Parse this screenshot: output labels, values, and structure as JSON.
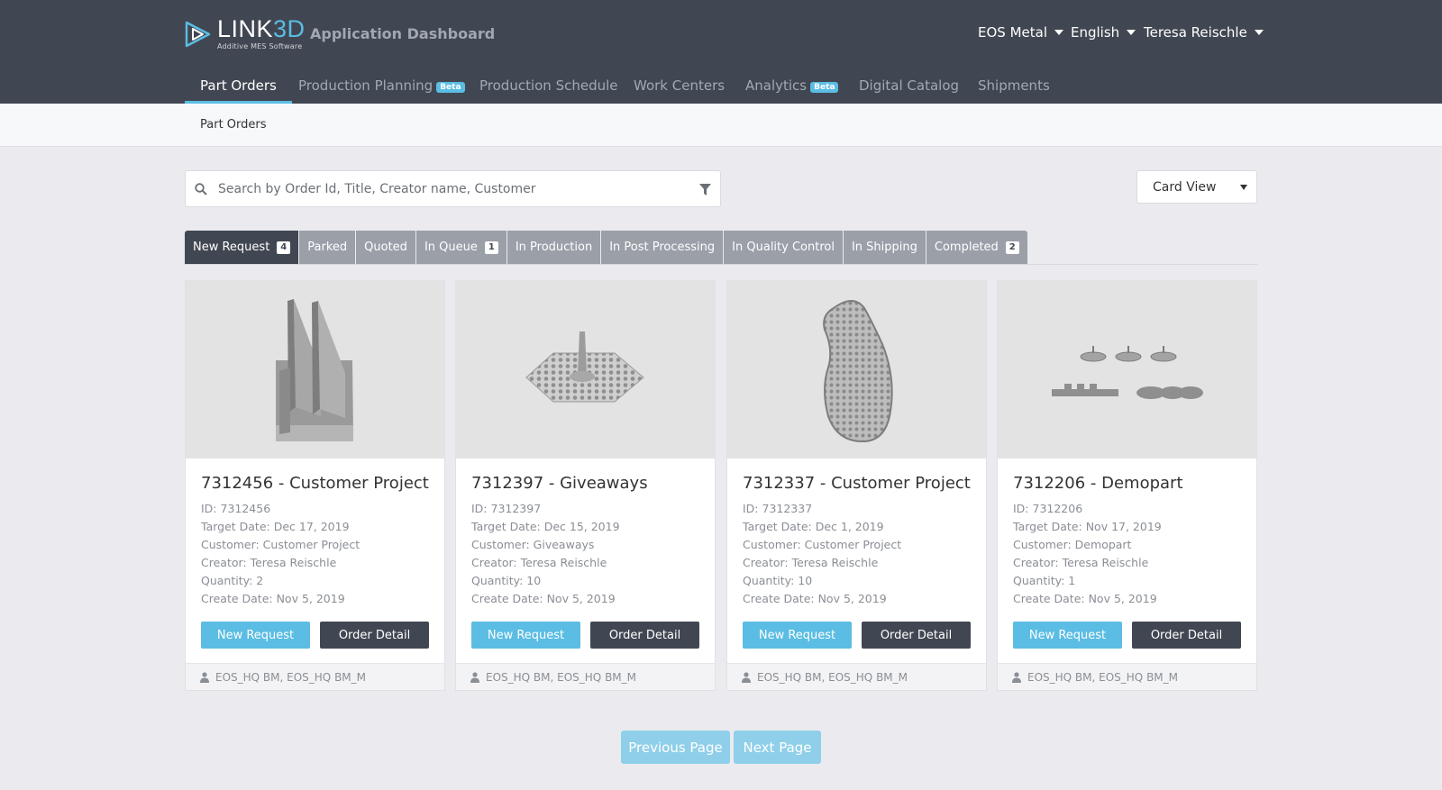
{
  "colors": {
    "header_bg": "#414752",
    "accent": "#5bbde3",
    "tab_inactive": "#9a9fa8"
  },
  "brand": {
    "logo_main": "LINK",
    "logo_accent": "3D",
    "logo_sub": "Additive MES Software",
    "app_title": "Application Dashboard"
  },
  "header_menus": {
    "workspace": "EOS Metal",
    "language": "English",
    "user": "Teresa Reischle"
  },
  "nav": {
    "part_orders": "Part Orders",
    "production_planning": "Production Planning",
    "production_schedule": "Production Schedule",
    "work_centers": "Work Centers",
    "analytics": "Analytics",
    "digital_catalog": "Digital Catalog",
    "shipments": "Shipments",
    "beta_badge": "Beta"
  },
  "breadcrumb": "Part Orders",
  "search": {
    "placeholder": "Search by Order Id, Title, Creator name, Customer"
  },
  "view_select": "Card View",
  "tabs": [
    {
      "label": "New Request",
      "count": "4"
    },
    {
      "label": "Parked"
    },
    {
      "label": "Quoted"
    },
    {
      "label": "In Queue",
      "count": "1"
    },
    {
      "label": "In Production"
    },
    {
      "label": "In Post Processing"
    },
    {
      "label": "In Quality Control"
    },
    {
      "label": "In Shipping"
    },
    {
      "label": "Completed",
      "count": "2"
    }
  ],
  "cards": [
    {
      "title": "7312456 - Customer Project",
      "id": "ID: 7312456",
      "target": "Target Date: Dec 17, 2019",
      "customer": "Customer: Customer Project",
      "creator": "Creator: Teresa Reischle",
      "quantity": "Quantity: 2",
      "created": "Create Date: Nov 5, 2019",
      "btn_status": "New Request",
      "btn_detail": "Order Detail",
      "footer": "EOS_HQ BM, EOS_HQ BM_M"
    },
    {
      "title": "7312397 - Giveaways",
      "id": "ID: 7312397",
      "target": "Target Date: Dec 15, 2019",
      "customer": "Customer: Giveaways",
      "creator": "Creator: Teresa Reischle",
      "quantity": "Quantity: 10",
      "created": "Create Date: Nov 5, 2019",
      "btn_status": "New Request",
      "btn_detail": "Order Detail",
      "footer": "EOS_HQ BM, EOS_HQ BM_M"
    },
    {
      "title": "7312337 - Customer Project",
      "id": "ID: 7312337",
      "target": "Target Date: Dec 1, 2019",
      "customer": "Customer: Customer Project",
      "creator": "Creator: Teresa Reischle",
      "quantity": "Quantity: 10",
      "created": "Create Date: Nov 5, 2019",
      "btn_status": "New Request",
      "btn_detail": "Order Detail",
      "footer": "EOS_HQ BM, EOS_HQ BM_M"
    },
    {
      "title": "7312206 - Demopart",
      "id": "ID: 7312206",
      "target": "Target Date: Nov 17, 2019",
      "customer": "Customer: Demopart",
      "creator": "Creator: Teresa Reischle",
      "quantity": "Quantity: 1",
      "created": "Create Date: Nov 5, 2019",
      "btn_status": "New Request",
      "btn_detail": "Order Detail",
      "footer": "EOS_HQ BM, EOS_HQ BM_M"
    }
  ],
  "pagination": {
    "previous": "Previous Page",
    "next": "Next Page"
  },
  "icons": {
    "search": "search-icon",
    "filter": "filter-icon",
    "user": "user-icon",
    "caret": "caret-down-icon",
    "logo": "link3d-logo-icon"
  }
}
